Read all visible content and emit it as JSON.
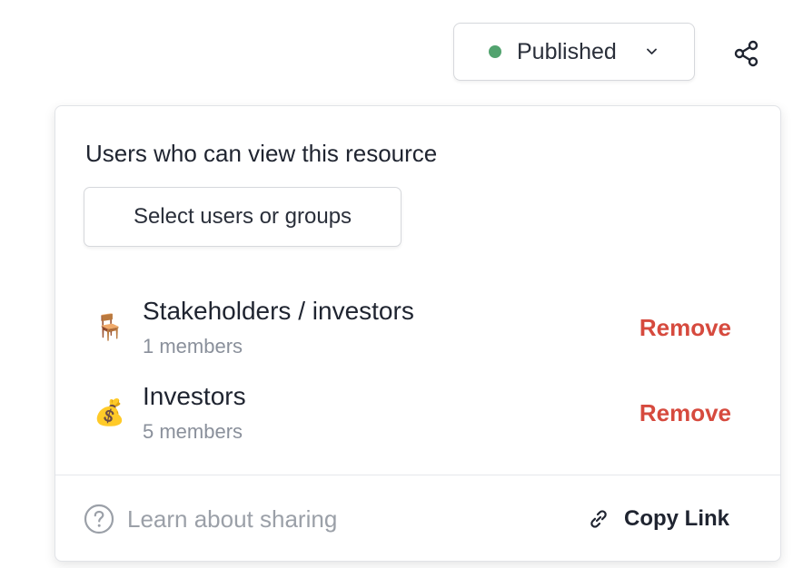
{
  "status": {
    "label": "Published",
    "dot_color": "#52a36f",
    "chevron_icon": "chevron-down-icon"
  },
  "share_icon": "share-icon",
  "panel": {
    "title": "Users who can view this resource",
    "select_button_label": "Select users or groups",
    "members": [
      {
        "emoji": "🪑",
        "name": "Stakeholders / investors",
        "count": "1 members",
        "action": "Remove"
      },
      {
        "emoji": "💰",
        "name": "Investors",
        "count": "5 members",
        "action": "Remove"
      }
    ],
    "footer": {
      "learn_label": "Learn about sharing",
      "learn_icon": "help-circle-icon",
      "copy_label": "Copy Link",
      "copy_icon": "link-icon"
    }
  },
  "colors": {
    "remove": "#d64a3e",
    "muted_text": "#9ba0a8"
  }
}
